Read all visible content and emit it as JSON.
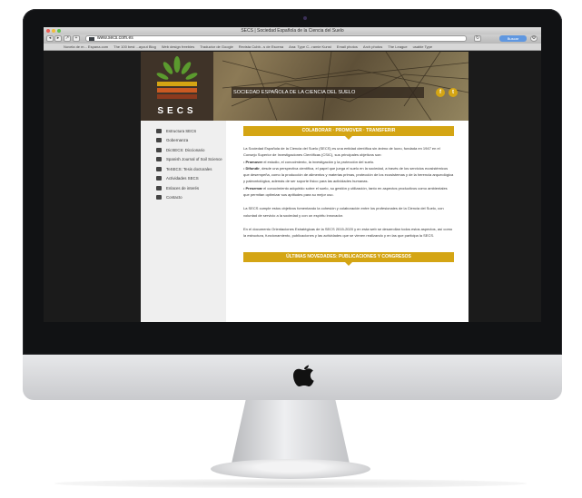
{
  "browser": {
    "window_title": "SECS | Sociedad Española de la Ciencia del Suelo",
    "url": "www.secs.com.es",
    "search_button": "Buscar",
    "bookmarks": [
      "Novela de m... Espana.com",
      "The 100 best ...ayout Blog",
      "Web design freebies",
      "Traductor de Google",
      "Revista Cubb...s de Escena",
      "Ana: Type C...ramie Kunst",
      "Email photos",
      "Arch photos",
      "The League",
      "usable Type"
    ]
  },
  "site": {
    "title": "SOCIEDAD ESPAÑOLA DE LA CIENCIA DEL SUELO",
    "logo_text": "SECS",
    "social": [
      "f",
      "t"
    ]
  },
  "sidebar": {
    "items": [
      {
        "label": "Estructura SECS",
        "icon": "org-chart-icon"
      },
      {
        "label": "Gobernanza",
        "icon": "people-icon"
      },
      {
        "label": "DicSECS: Diccionario",
        "icon": "book-icon"
      },
      {
        "label": "Spanish Journal of Soil Science",
        "icon": "journal-icon"
      },
      {
        "label": "TeSECS: Tesis doctorales",
        "icon": "pen-icon"
      },
      {
        "label": "Actividades SECS",
        "icon": "car-icon"
      },
      {
        "label": "Enlaces de interés",
        "icon": "link-icon"
      },
      {
        "label": "Contacto",
        "icon": "mail-icon"
      }
    ]
  },
  "content": {
    "banner": "COLABORAR · PROMOVER · TRANSFERIR",
    "intro": "La Sociedad Española de la Ciencia del Suelo (SECS) es una entidad científica sin ánimo de lucro, fundada en 1947 en el Consejo Superior de Investigaciones Científicas (CSIC), sus principales objetivos son:",
    "goal1_key": "Promover",
    "goal1_text": "el estudio, el conocimiento, la investigación y la protección del suelo.",
    "goal2_key": "Difundir",
    "goal2_text": "desde una perspectiva científica, el papel que juega el suelo en la sociedad, a través de los servicios ecosistémicos que desempeña, como la producción de alimentos y materias primas, protección de los ecosistemas y de la herencia arqueológica y paleontológica, además de ser soporte físico para las actividades humanas.",
    "goal3_key": "Preservar",
    "goal3_text": "el conocimiento adquirido sobre el suelo, su gestión y utilización, tanto en aspectos productivos como ambientales que permitan optimizar sus aptitudes para su mejor uso.",
    "para2": "La SECS cumple estos objetivos fomentando la cohesión y colaboración entre los profesionales de la Ciencia del Suelo, con voluntad de servicio a la sociedad y con un espíritu innovador.",
    "para3": "En el documento Orientaciones Estratégicas de la SECS 2015-2020 y en esta web se desarrollan todos estos aspectos, así como la estructura, funcionamiento, publicaciones y las actividades que se vienen realizando y en las que participa la SECS.",
    "banner2": "ÚLTIMAS NOVEDADES: PUBLICACIONES Y CONGRESOS"
  },
  "colors": {
    "accent": "#d4a514",
    "header_dark": "#3f3328",
    "sidebar_bg": "#efefef",
    "page_bg": "#1b1b1b"
  }
}
